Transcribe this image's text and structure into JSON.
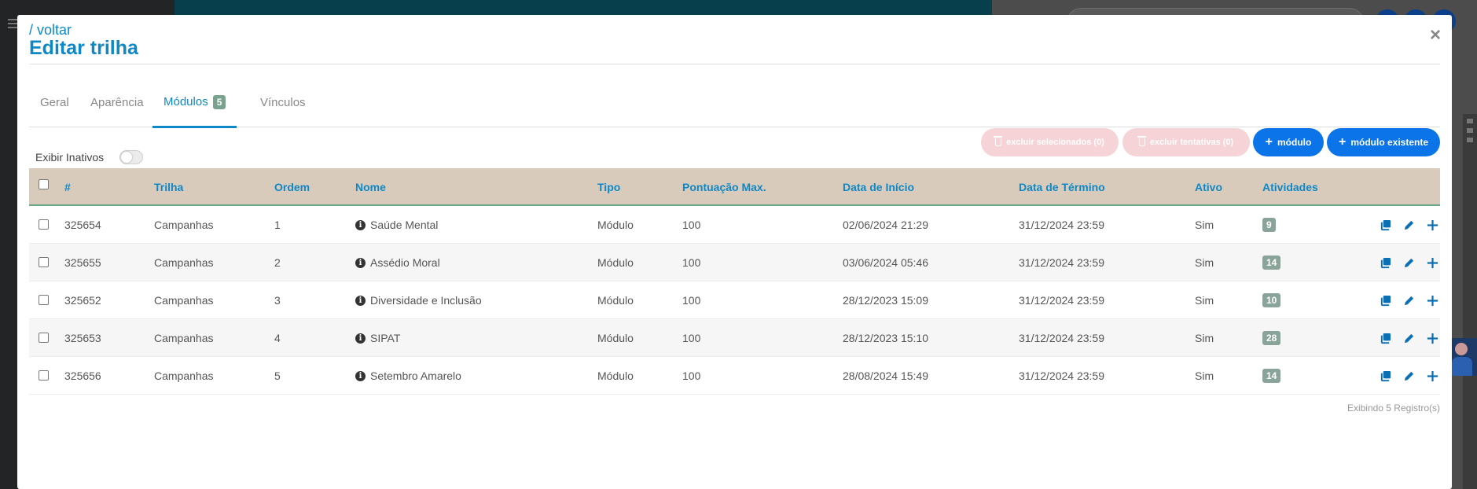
{
  "modal": {
    "back_label": "/ voltar",
    "title": "Editar trilha",
    "close_glyph": "×"
  },
  "tabs": [
    {
      "label": "Geral",
      "active": false
    },
    {
      "label": "Aparência",
      "active": false
    },
    {
      "label": "Módulos",
      "active": true,
      "badge": "5"
    },
    {
      "label": "Vínculos",
      "active": false
    }
  ],
  "toolbar": {
    "show_inactive_label": "Exibir Inativos",
    "show_inactive_on": false,
    "delete_selected_label": "excluir selecionados (0)",
    "delete_attempts_label": "excluir tentativas (0)",
    "add_module_label": "módulo",
    "add_existing_module_label": "módulo existente"
  },
  "table": {
    "columns": [
      "#",
      "Trilha",
      "Ordem",
      "Nome",
      "Tipo",
      "Pontuação Max.",
      "Data de Início",
      "Data de Término",
      "Ativo",
      "Atividades"
    ],
    "rows": [
      {
        "id": "325654",
        "trilha": "Campanhas",
        "ordem": "1",
        "nome": "Saúde Mental",
        "tipo": "Módulo",
        "pontuacao": "100",
        "inicio": "02/06/2024 21:29",
        "termino": "31/12/2024 23:59",
        "ativo": "Sim",
        "atividades": "9"
      },
      {
        "id": "325655",
        "trilha": "Campanhas",
        "ordem": "2",
        "nome": "Assédio Moral",
        "tipo": "Módulo",
        "pontuacao": "100",
        "inicio": "03/06/2024 05:46",
        "termino": "31/12/2024 23:59",
        "ativo": "Sim",
        "atividades": "14"
      },
      {
        "id": "325652",
        "trilha": "Campanhas",
        "ordem": "3",
        "nome": "Diversidade e Inclusão",
        "tipo": "Módulo",
        "pontuacao": "100",
        "inicio": "28/12/2023 15:09",
        "termino": "31/12/2024 23:59",
        "ativo": "Sim",
        "atividades": "10"
      },
      {
        "id": "325653",
        "trilha": "Campanhas",
        "ordem": "4",
        "nome": "SIPAT",
        "tipo": "Módulo",
        "pontuacao": "100",
        "inicio": "28/12/2023 15:10",
        "termino": "31/12/2024 23:59",
        "ativo": "Sim",
        "atividades": "28"
      },
      {
        "id": "325656",
        "trilha": "Campanhas",
        "ordem": "5",
        "nome": "Setembro Amarelo",
        "tipo": "Módulo",
        "pontuacao": "100",
        "inicio": "28/08/2024 15:49",
        "termino": "31/12/2024 23:59",
        "ativo": "Sim",
        "atividades": "14"
      }
    ],
    "footer": "Exibindo 5 Registro(s)"
  },
  "colors": {
    "accent": "#0e88c6",
    "primary_button": "#0a74e8",
    "danger_disabled": "#f6d3d6",
    "header_bg": "#d8cbbc",
    "badge": "#8aa49a"
  },
  "icons": {
    "row_actions": [
      "copy-icon",
      "edit-icon",
      "add-icon"
    ],
    "name_prefix": "info-icon"
  }
}
